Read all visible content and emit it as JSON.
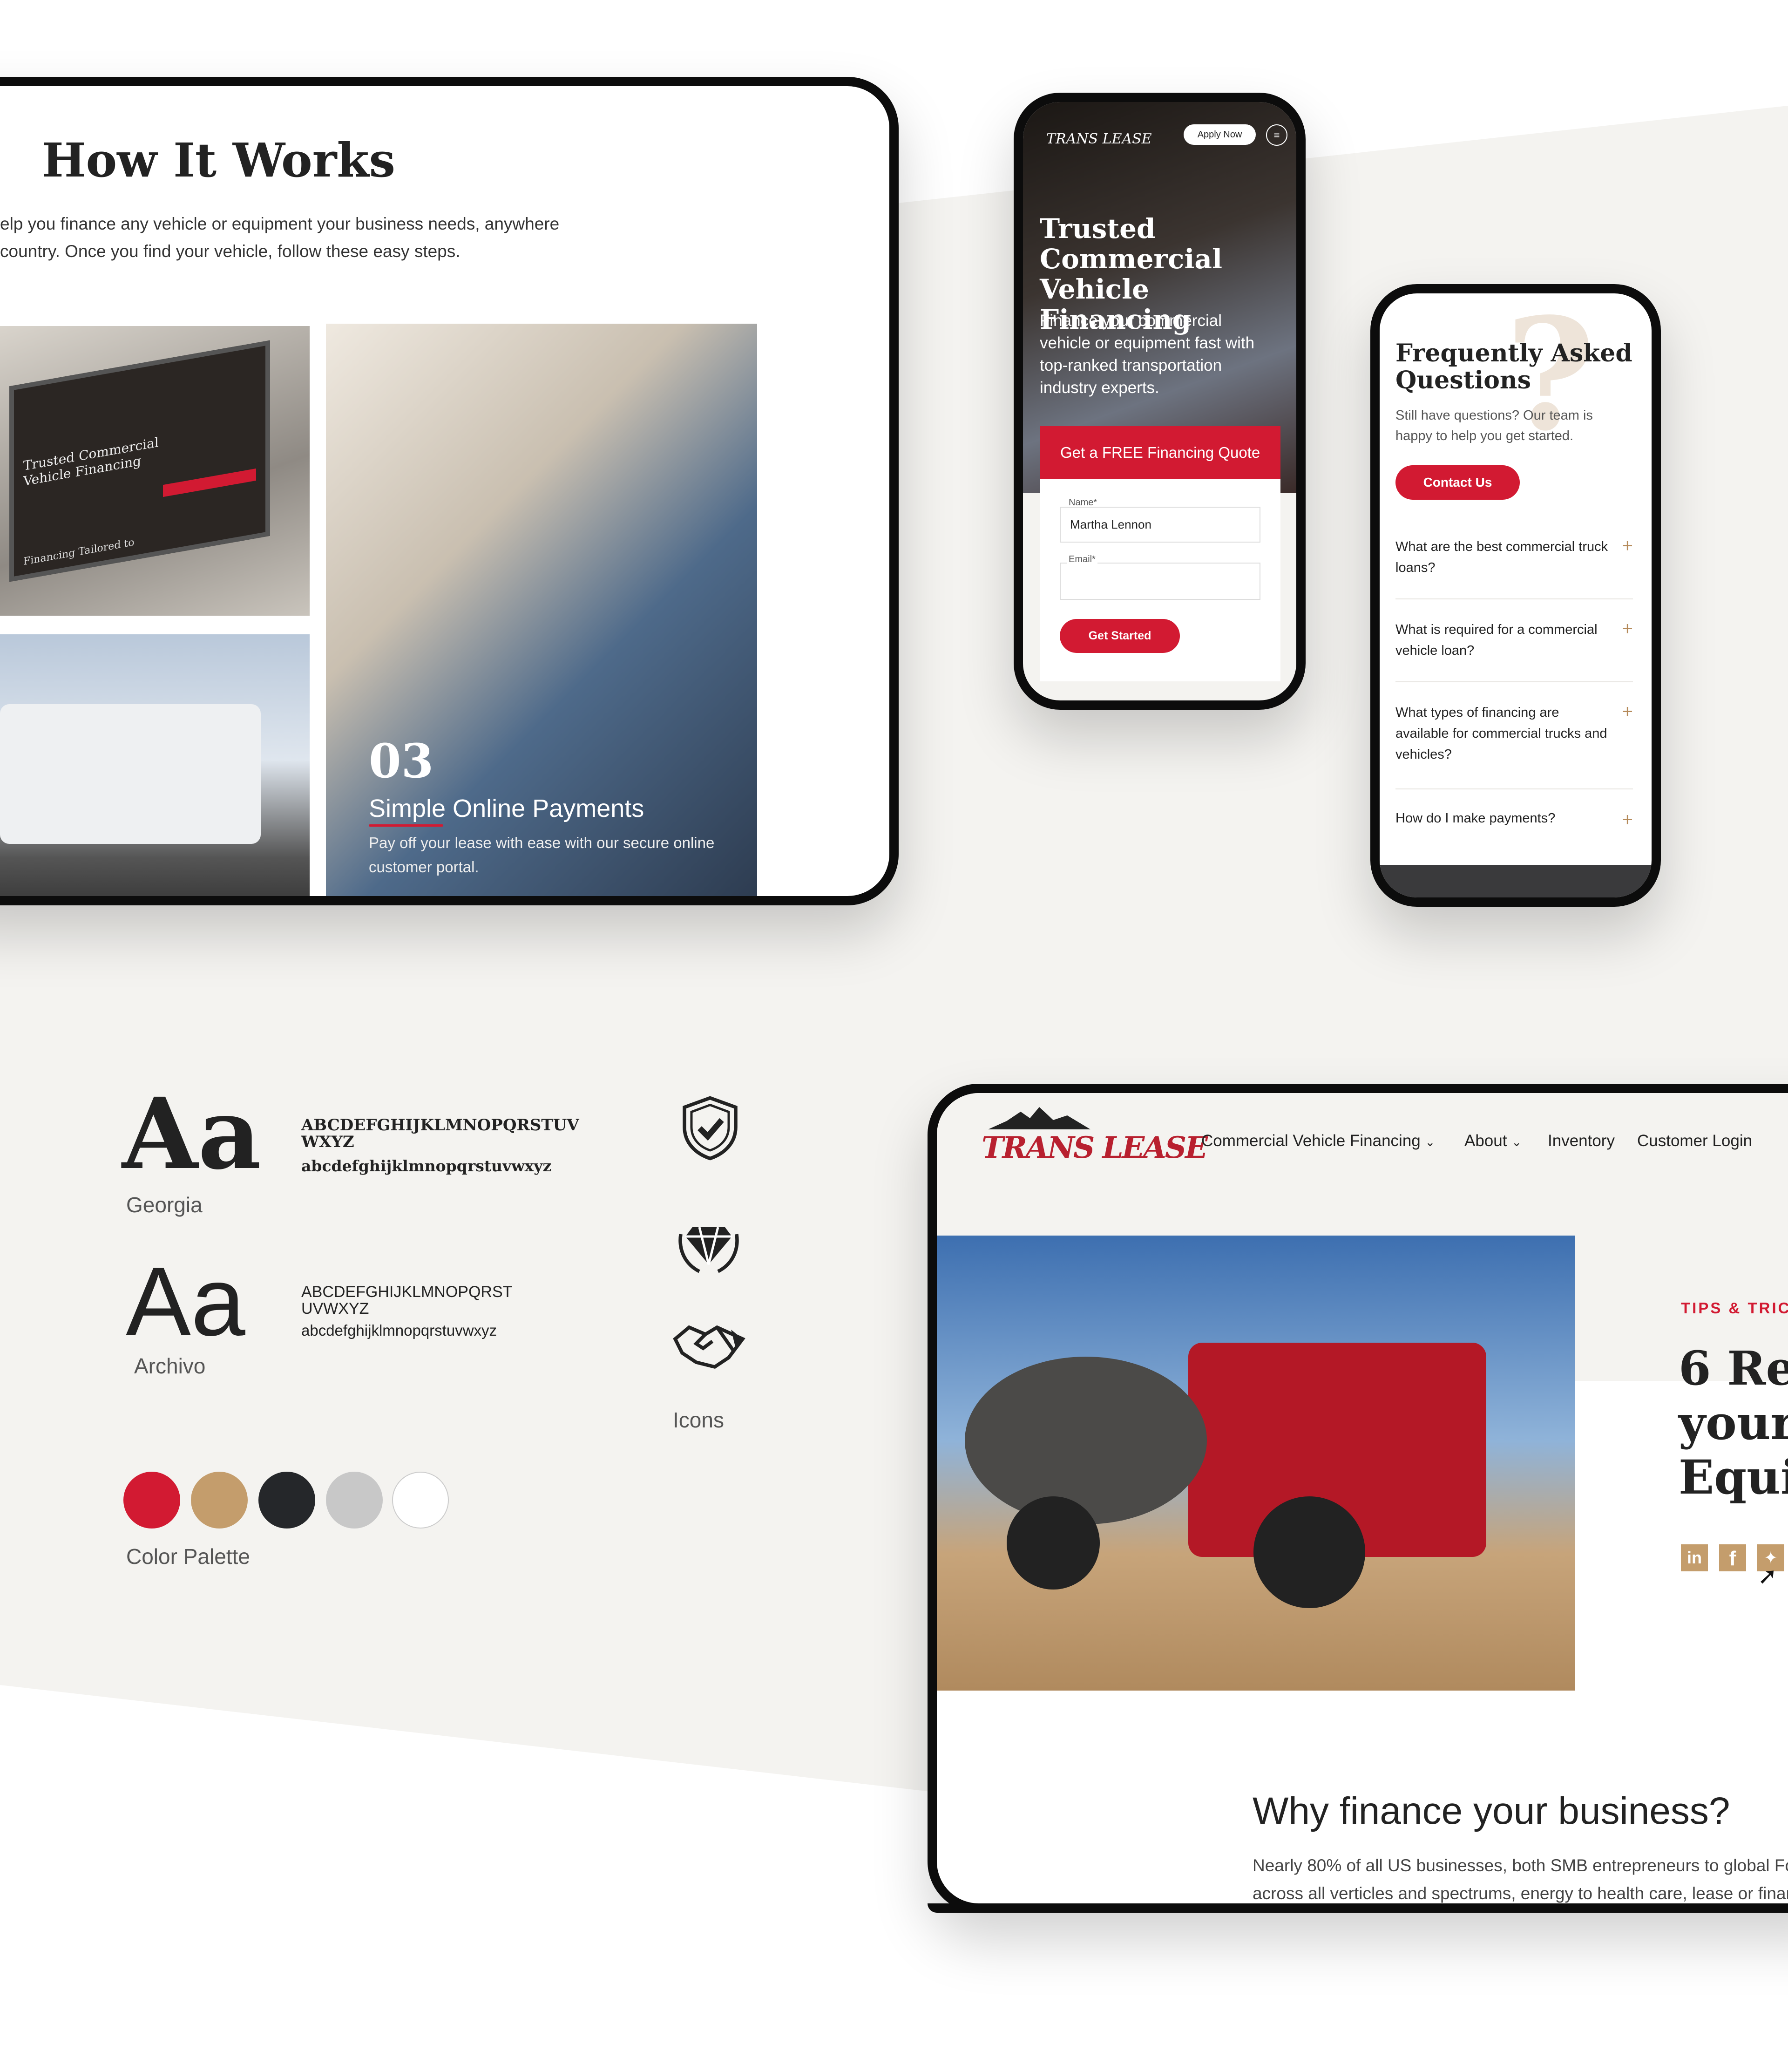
{
  "how_it_works": {
    "title": "How It Works",
    "intro_line1": "elp you finance any vehicle or equipment your business needs, anywhere",
    "intro_line2": "country. Once you find your vehicle, follow these easy steps.",
    "laptop_hero_text": "Trusted Commercial Vehicle Financing",
    "laptop_sub_text": "Financing Tailored to",
    "step_number": "03",
    "step_title": "Simple Online Payments",
    "step_desc_line1": "Pay off your lease with ease with our secure online",
    "step_desc_line2": "customer portal."
  },
  "mobile_hero": {
    "logo": "TRANS LEASE",
    "apply_label": "Apply Now",
    "menu_icon": "hamburger-icon",
    "title_lines": [
      "Trusted",
      "Commercial",
      "Vehicle Financing"
    ],
    "desc": "Finance your commercial vehicle or equipment fast with top-ranked transportation industry experts.",
    "quote_band": "Get a FREE Financing Quote",
    "name_label": "Name*",
    "name_value": "Martha Lennon",
    "email_label": "Email*",
    "email_value": "",
    "submit_label": "Get Started"
  },
  "mobile_faq": {
    "title_line1": "Frequently Asked",
    "title_line2": "Questions",
    "desc": "Still have questions? Our team is happy to help you get started.",
    "contact_label": "Contact Us",
    "questions": [
      "What are the best commercial truck loans?",
      "What is required for a commercial vehicle loan?",
      "What types of financing are available for commercial trucks and vehicles?",
      "How do I make payments?"
    ]
  },
  "style_guide": {
    "serif_sample": "Aa",
    "serif_upper": "ABCDEFGHIJKLMNOPQRSTUV WXYZ",
    "serif_lower": "abcdefghijklmnopqrstuvwxyz",
    "serif_name": "Georgia",
    "sans_sample": "Aa",
    "sans_upper": "ABCDEFGHIJKLMNOPQRST UVWXYZ",
    "sans_lower": "abcdefghijklmnopqrstuvwxyz",
    "sans_name": "Archivo",
    "icons_label": "Icons",
    "icons": [
      "shield-check-icon",
      "hands-diamond-icon",
      "handshake-icon"
    ],
    "palette_label": "Color Palette",
    "colors": [
      "#d21a32",
      "#c49d6c",
      "#25272a",
      "#c8c8c8",
      "#ffffff"
    ]
  },
  "desktop": {
    "logo": "TRANS LEASE",
    "nav": [
      {
        "label": "Commercial Vehicle Financing",
        "dropdown": true
      },
      {
        "label": "About",
        "dropdown": true
      },
      {
        "label": "Inventory",
        "dropdown": false
      },
      {
        "label": "Customer Login",
        "dropdown": false
      }
    ],
    "eyebrow": "TIPS & TRIC",
    "heading_lines": [
      "6 Re",
      "your",
      "Equi"
    ],
    "social": [
      "linkedin-icon",
      "facebook-icon",
      "twitter-icon"
    ],
    "section_title": "Why finance your business?",
    "section_line1": "Nearly 80% of all US businesses, both SMB entrepreneurs to global Fo",
    "section_line2": "across all verticles and spectrums, energy to health care, lease or finan"
  },
  "colors": {
    "brand_red": "#d21a32",
    "tan": "#c49d6c",
    "dark": "#25272a",
    "bg": "#f4f3f0"
  }
}
